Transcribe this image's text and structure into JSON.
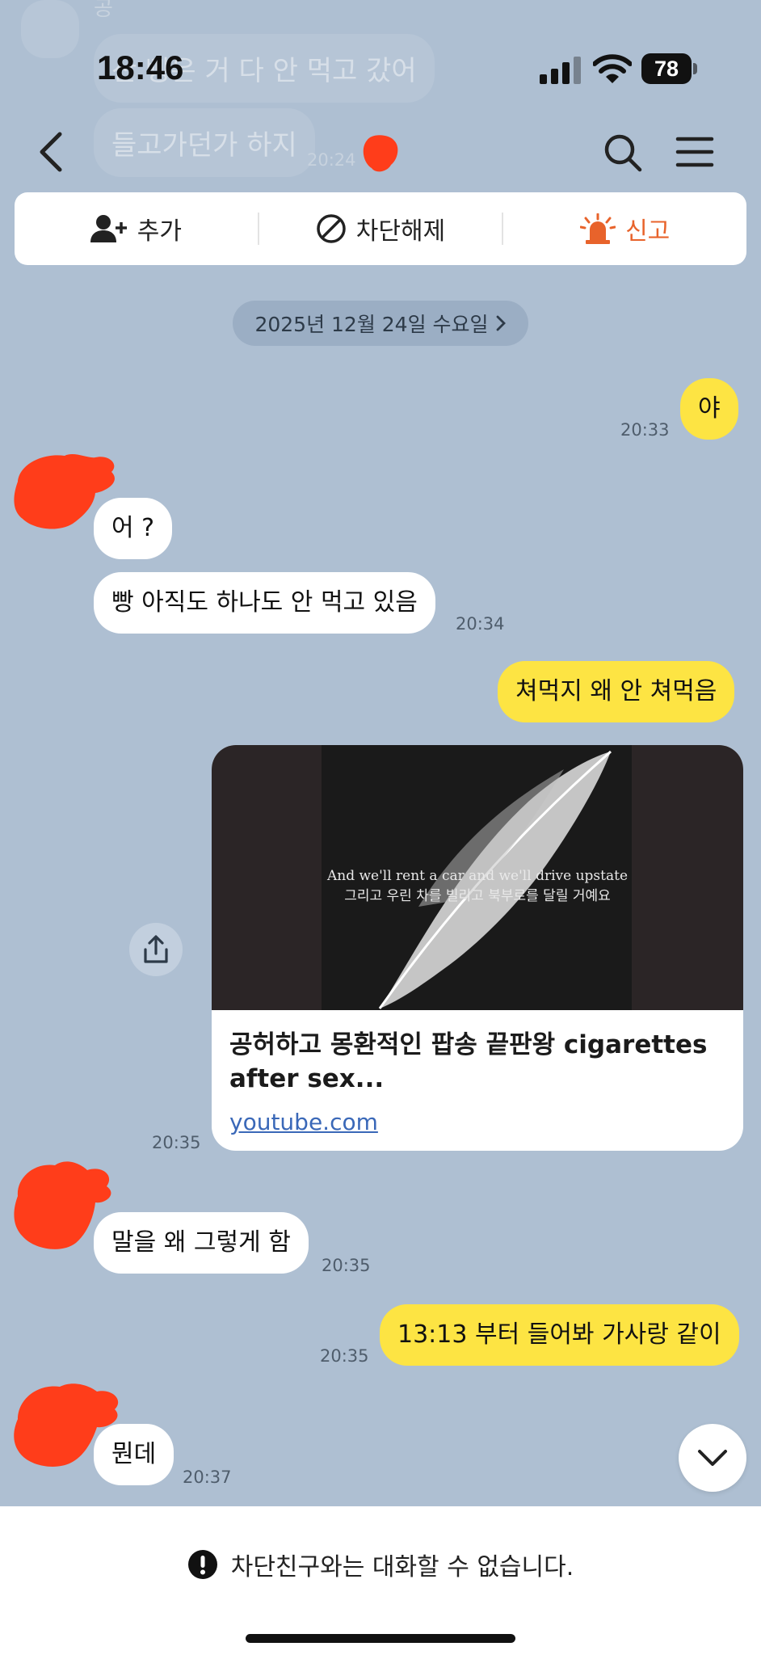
{
  "status_bar": {
    "time": "18:46",
    "battery": "78"
  },
  "ghost": {
    "char": "공",
    "line1": "산 빵은 거 다 안 먹고 갔어",
    "line2": "들고가던가 하지",
    "time": "20:24"
  },
  "actions": {
    "add": "추가",
    "unblock": "차단해제",
    "report": "신고"
  },
  "date_divider": "2025년 12월 24일 수요일",
  "messages": [
    {
      "from": "me",
      "text": "야",
      "time": "20:33"
    },
    {
      "from": "them",
      "text": "어 ?"
    },
    {
      "from": "them",
      "text": "빵 아직도 하나도 안 먹고 있음",
      "time": "20:34"
    },
    {
      "from": "me",
      "text": "쳐먹지 왜 안 쳐먹음"
    },
    {
      "from": "them",
      "text": "말을 왜 그렇게 함",
      "time": "20:35"
    },
    {
      "from": "me",
      "text": "13:13 부터 들어봐 가사랑 같이",
      "time": "20:35"
    },
    {
      "from": "them",
      "text": "뭔데",
      "time": "20:37"
    }
  ],
  "link_card": {
    "subtitle_en": "And we'll rent a car and we'll drive upstate",
    "subtitle_ko": "그리고 우린 차를 빌리고 북부로를 달릴 거예요",
    "title": "공허하고 몽환적인 팝송 끝판왕 cigarettes after sex...",
    "url": "youtube.com",
    "time": "20:35"
  },
  "footer": {
    "notice": "차단친구와는 대화할 수 없습니다."
  },
  "colors": {
    "background": "#aebfd2",
    "my_bubble": "#fde443",
    "their_bubble": "#ffffff",
    "report_accent": "#e8632b",
    "link": "#3a68b8",
    "redaction": "#ff3d1a"
  }
}
